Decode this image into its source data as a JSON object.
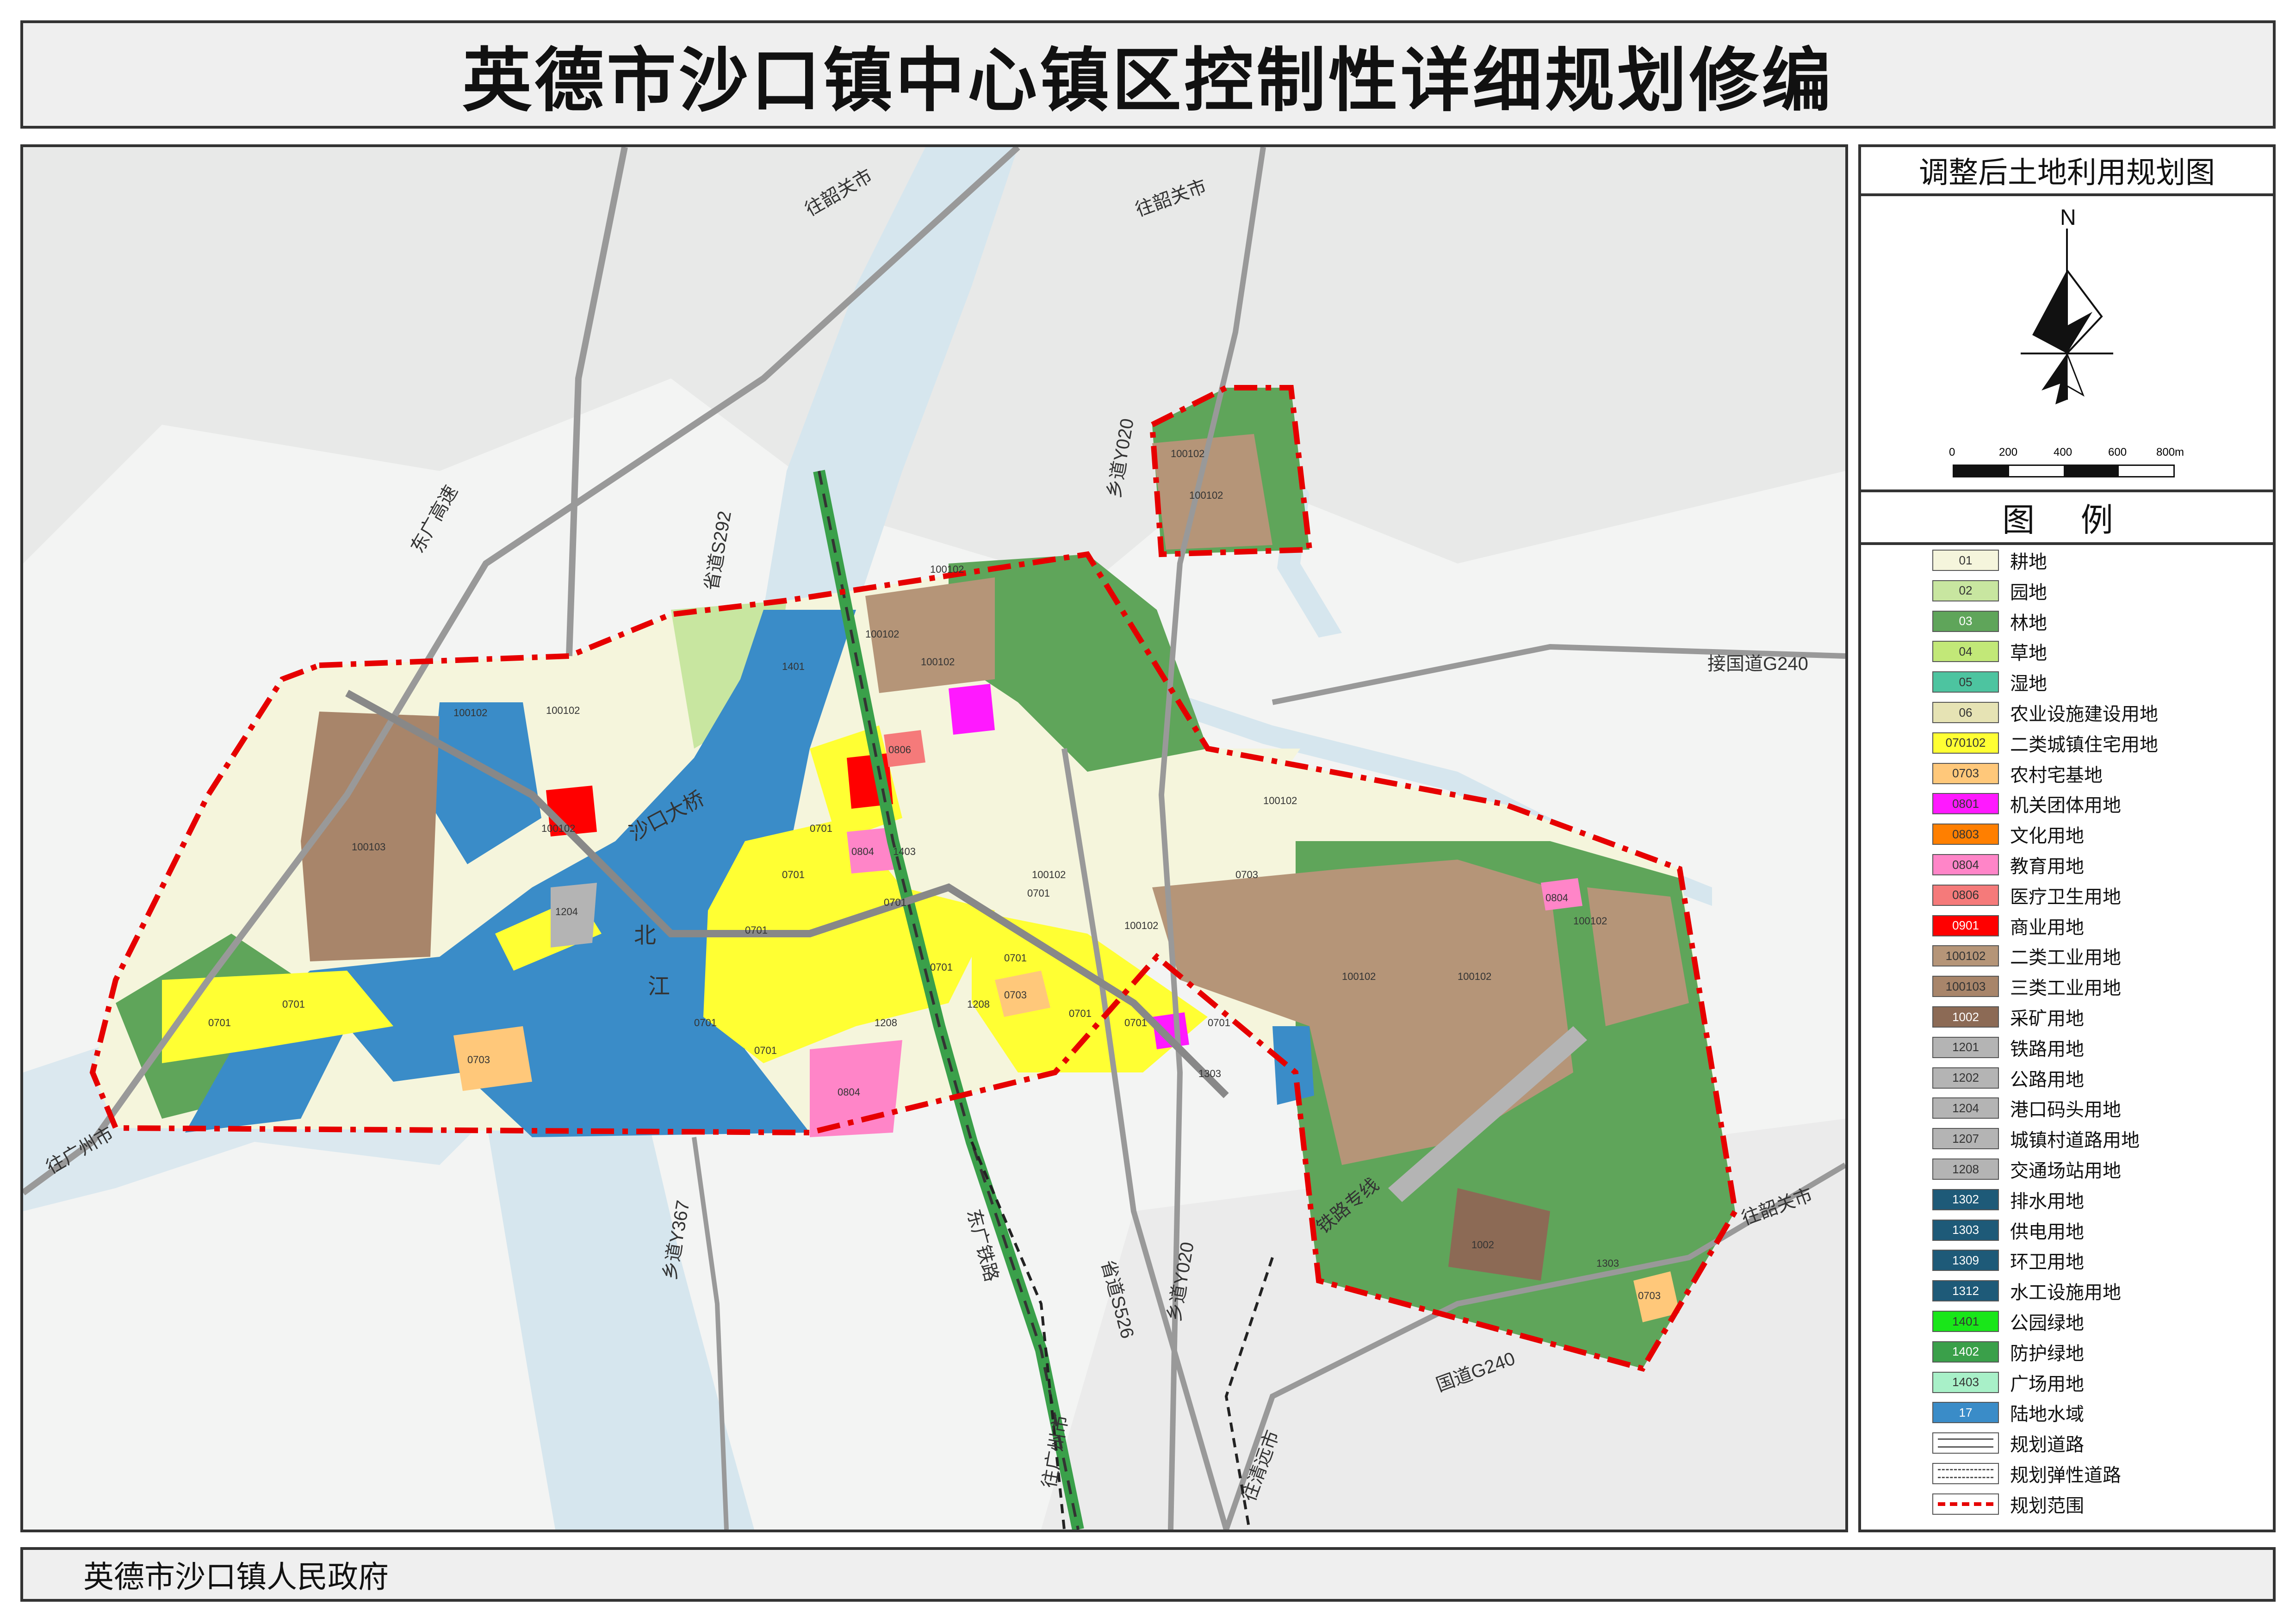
{
  "title": "英德市沙口镇中心镇区控制性详细规划修编",
  "footer": "英德市沙口镇人民政府",
  "map_title": "调整后土地利用规划图",
  "compass": {
    "north_label": "N"
  },
  "scale_bar": {
    "ticks": [
      "0",
      "200",
      "400",
      "600",
      "800m"
    ]
  },
  "legend_title": "图 例",
  "legend": [
    {
      "code": "01",
      "label": "耕地",
      "color": "#f5f5dc"
    },
    {
      "code": "02",
      "label": "园地",
      "color": "#c8e6a0"
    },
    {
      "code": "03",
      "label": "林地",
      "color": "#5fa55a"
    },
    {
      "code": "04",
      "label": "草地",
      "color": "#c2e878"
    },
    {
      "code": "05",
      "label": "湿地",
      "color": "#4dc4a0"
    },
    {
      "code": "06",
      "label": "农业设施建设用地",
      "color": "#e6e3b4"
    },
    {
      "code": "070102",
      "label": "二类城镇住宅用地",
      "color": "#ffff33"
    },
    {
      "code": "0703",
      "label": "农村宅基地",
      "color": "#ffc87a"
    },
    {
      "code": "0801",
      "label": "机关团体用地",
      "color": "#ff19ff"
    },
    {
      "code": "0803",
      "label": "文化用地",
      "color": "#ff7f00"
    },
    {
      "code": "0804",
      "label": "教育用地",
      "color": "#ff85c8"
    },
    {
      "code": "0806",
      "label": "医疗卫生用地",
      "color": "#f57a7a"
    },
    {
      "code": "0901",
      "label": "商业用地",
      "color": "#ff0000"
    },
    {
      "code": "100102",
      "label": "二类工业用地",
      "color": "#b59578"
    },
    {
      "code": "100103",
      "label": "三类工业用地",
      "color": "#a8856a"
    },
    {
      "code": "1002",
      "label": "采矿用地",
      "color": "#8c6a55"
    },
    {
      "code": "1201",
      "label": "铁路用地",
      "color": "#b4b4b4"
    },
    {
      "code": "1202",
      "label": "公路用地",
      "color": "#b4b4b4"
    },
    {
      "code": "1204",
      "label": "港口码头用地",
      "color": "#b4b4b4"
    },
    {
      "code": "1207",
      "label": "城镇村道路用地",
      "color": "#b4b4b4"
    },
    {
      "code": "1208",
      "label": "交通场站用地",
      "color": "#b4b4b4"
    },
    {
      "code": "1302",
      "label": "排水用地",
      "color": "#1e5a78"
    },
    {
      "code": "1303",
      "label": "供电用地",
      "color": "#1e5a78"
    },
    {
      "code": "1309",
      "label": "环卫用地",
      "color": "#1e5a78"
    },
    {
      "code": "1312",
      "label": "水工设施用地",
      "color": "#1e5a78"
    },
    {
      "code": "1401",
      "label": "公园绿地",
      "color": "#19e619"
    },
    {
      "code": "1402",
      "label": "防护绿地",
      "color": "#3aa04a"
    },
    {
      "code": "1403",
      "label": "广场用地",
      "color": "#a8f0c8"
    },
    {
      "code": "17",
      "label": "陆地水域",
      "color": "#3a8cc8"
    },
    {
      "code": "",
      "label": "规划道路",
      "color": "#ffffff",
      "style": "road"
    },
    {
      "code": "",
      "label": "规划弹性道路",
      "color": "#ffffff",
      "style": "dashed-road"
    },
    {
      "code": "",
      "label": "规划范围",
      "color": "#e60000",
      "style": "boundary"
    }
  ],
  "map_labels": {
    "bridge": "沙口大桥",
    "river_1": "北",
    "river_2": "江",
    "dongguang_expressway": "东广高速",
    "s292": "省道S292",
    "y020_north": "乡道Y020",
    "y020_south": "乡道Y020",
    "g240_connect": "接国道G240",
    "g240": "国道G240",
    "to_shaoguan_1": "往韶关市",
    "to_shaoguan_2": "往韶关市",
    "to_shaoguan_3": "往韶关市",
    "to_guangzhou_w": "往广州市",
    "to_guangzhou_s": "往广州市",
    "to_qingyuan": "往清远市",
    "y367": "乡道Y367",
    "s526": "省道S526",
    "dongguang_railway": "东广铁路",
    "railway_spur": "铁路专线"
  },
  "parcel_codes": {
    "p1": "100103",
    "p2": "100102",
    "p3": "100102",
    "p4": "100102",
    "p5": "100102",
    "p6": "100102",
    "p7": "100102",
    "p8": "100102",
    "p9": "100102",
    "p10": "100102",
    "p11": "0701",
    "p12": "0701",
    "p13": "0701",
    "p14": "0701",
    "p15": "0701",
    "p16": "0701",
    "p17": "0701",
    "p18": "0701",
    "p19": "0701",
    "p20": "0701",
    "p21": "0804",
    "p22": "0804",
    "p23": "0806",
    "p24": "0703",
    "p25": "0703",
    "p26": "0703",
    "p27": "1204",
    "p28": "1208",
    "p29": "1303",
    "p30": "1303",
    "p31": "100102",
    "p32": "100102",
    "p33": "0701",
    "p34": "0701",
    "p35": "0701",
    "p36": "0701",
    "p37": "0703",
    "p38": "0804",
    "p39": "100102",
    "p40": "1002",
    "p41": "100102",
    "p42": "100102",
    "p43": "1401",
    "p44": "1403",
    "p45": "1208"
  }
}
